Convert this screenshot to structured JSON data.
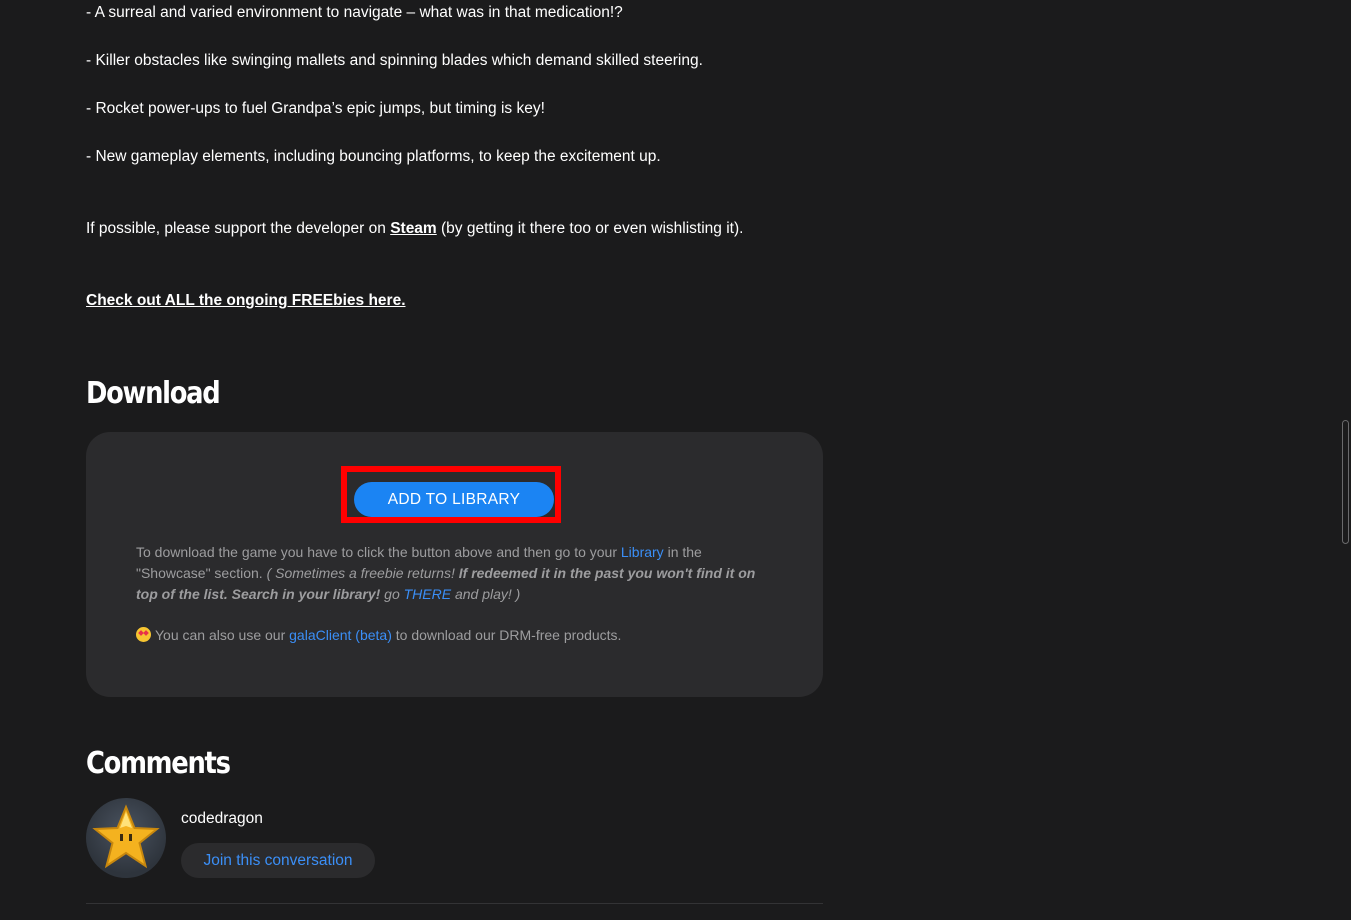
{
  "description": {
    "bullet_1": "- A surreal and varied environment to navigate – what was in that medication!?",
    "bullet_2": "- Killer obstacles like swinging mallets and spinning blades which demand skilled steering.",
    "bullet_3": "- Rocket power-ups to fuel Grandpa’s epic jumps, but timing is key!",
    "bullet_4": "- New gameplay elements, including bouncing platforms, to keep the excitement up.",
    "support_pre": "If possible, please support the developer on ",
    "support_link": "Steam",
    "support_post": " (by getting it there too or even wishlisting it).",
    "freebies_link": "Check out ALL the ongoing FREEbies here."
  },
  "download": {
    "heading": "Download",
    "button_label": "ADD TO LIBRARY",
    "info_part1": "To download the game you have to click the button above and then go to your ",
    "info_library_link": "Library",
    "info_part2": " in the \"Showcase\" section. ",
    "info_italic1": "( Sometimes a freebie returns! ",
    "info_bold_italic": "If redeemed it in the past you won't find it on top of the list. Search in your library!",
    "info_italic2": " go ",
    "info_there_link": "THERE",
    "info_italic3": " and play! )",
    "client_pre": "You can also use our ",
    "client_link": "galaClient (beta)",
    "client_post": " to download our DRM-free products.",
    "emoji_icon": "star-struck-emoji-icon"
  },
  "comments": {
    "heading": "Comments",
    "username": "codedragon",
    "join_label": "Join this conversation",
    "avatar_icon": "star-avatar-icon"
  },
  "colors": {
    "background": "#1b1b1c",
    "panel": "#2b2b2d",
    "accent_blue": "#1b84f3",
    "link_blue": "#3b8ff7",
    "highlight_red": "#ff0000",
    "muted_text": "#9d9d9f"
  }
}
